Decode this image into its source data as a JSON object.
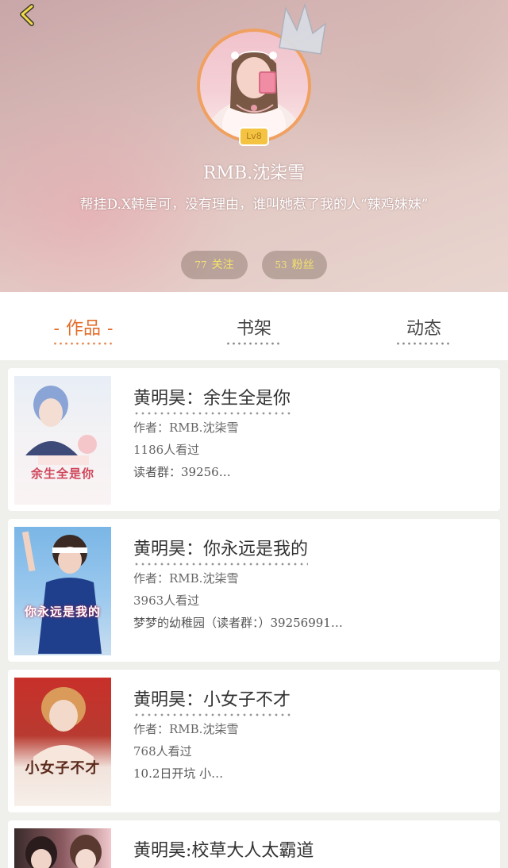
{
  "header": {
    "nickname": "RMB.沈柒雪",
    "level_badge": "Lv8",
    "bio": "帮挂D.X韩星可，没有理由，谁叫她惹了我的人“辣鸡妹妹”",
    "follow_count": "77",
    "follow_label": "关注",
    "fans_count": "53",
    "fans_label": "粉丝"
  },
  "tabs": [
    {
      "label": "作品",
      "active": true
    },
    {
      "label": "书架",
      "active": false
    },
    {
      "label": "动态",
      "active": false
    }
  ],
  "active_tab_dash": "-",
  "books": [
    {
      "title": "黄明昊：余生全是你",
      "author": "作者：RMB.沈柒雪",
      "reads": "1186人看过",
      "desc": "读者群：39256…",
      "cover_title": "余生全是你"
    },
    {
      "title": "黄明昊：你永远是我的",
      "author": "作者：RMB.沈柒雪",
      "reads": "3963人看过",
      "desc": "梦梦的幼稚园（读者群：）39256991…",
      "cover_title": "你永远是我的"
    },
    {
      "title": "黄明昊：小女子不才",
      "author": "作者：RMB.沈柒雪",
      "reads": "768人看过",
      "desc": "10.2日开坑 小…",
      "cover_title": "小女子不才"
    },
    {
      "title": "黄明昊:校草大人太霸道",
      "cover_title": ""
    }
  ],
  "colors": {
    "accent": "#e36d2a",
    "badge": "#f5c342",
    "avatar_border": "#f0a060",
    "pill_text": "#f4e26a"
  },
  "icons": {
    "back": "back-arrow-icon",
    "crown": "crown-icon"
  }
}
